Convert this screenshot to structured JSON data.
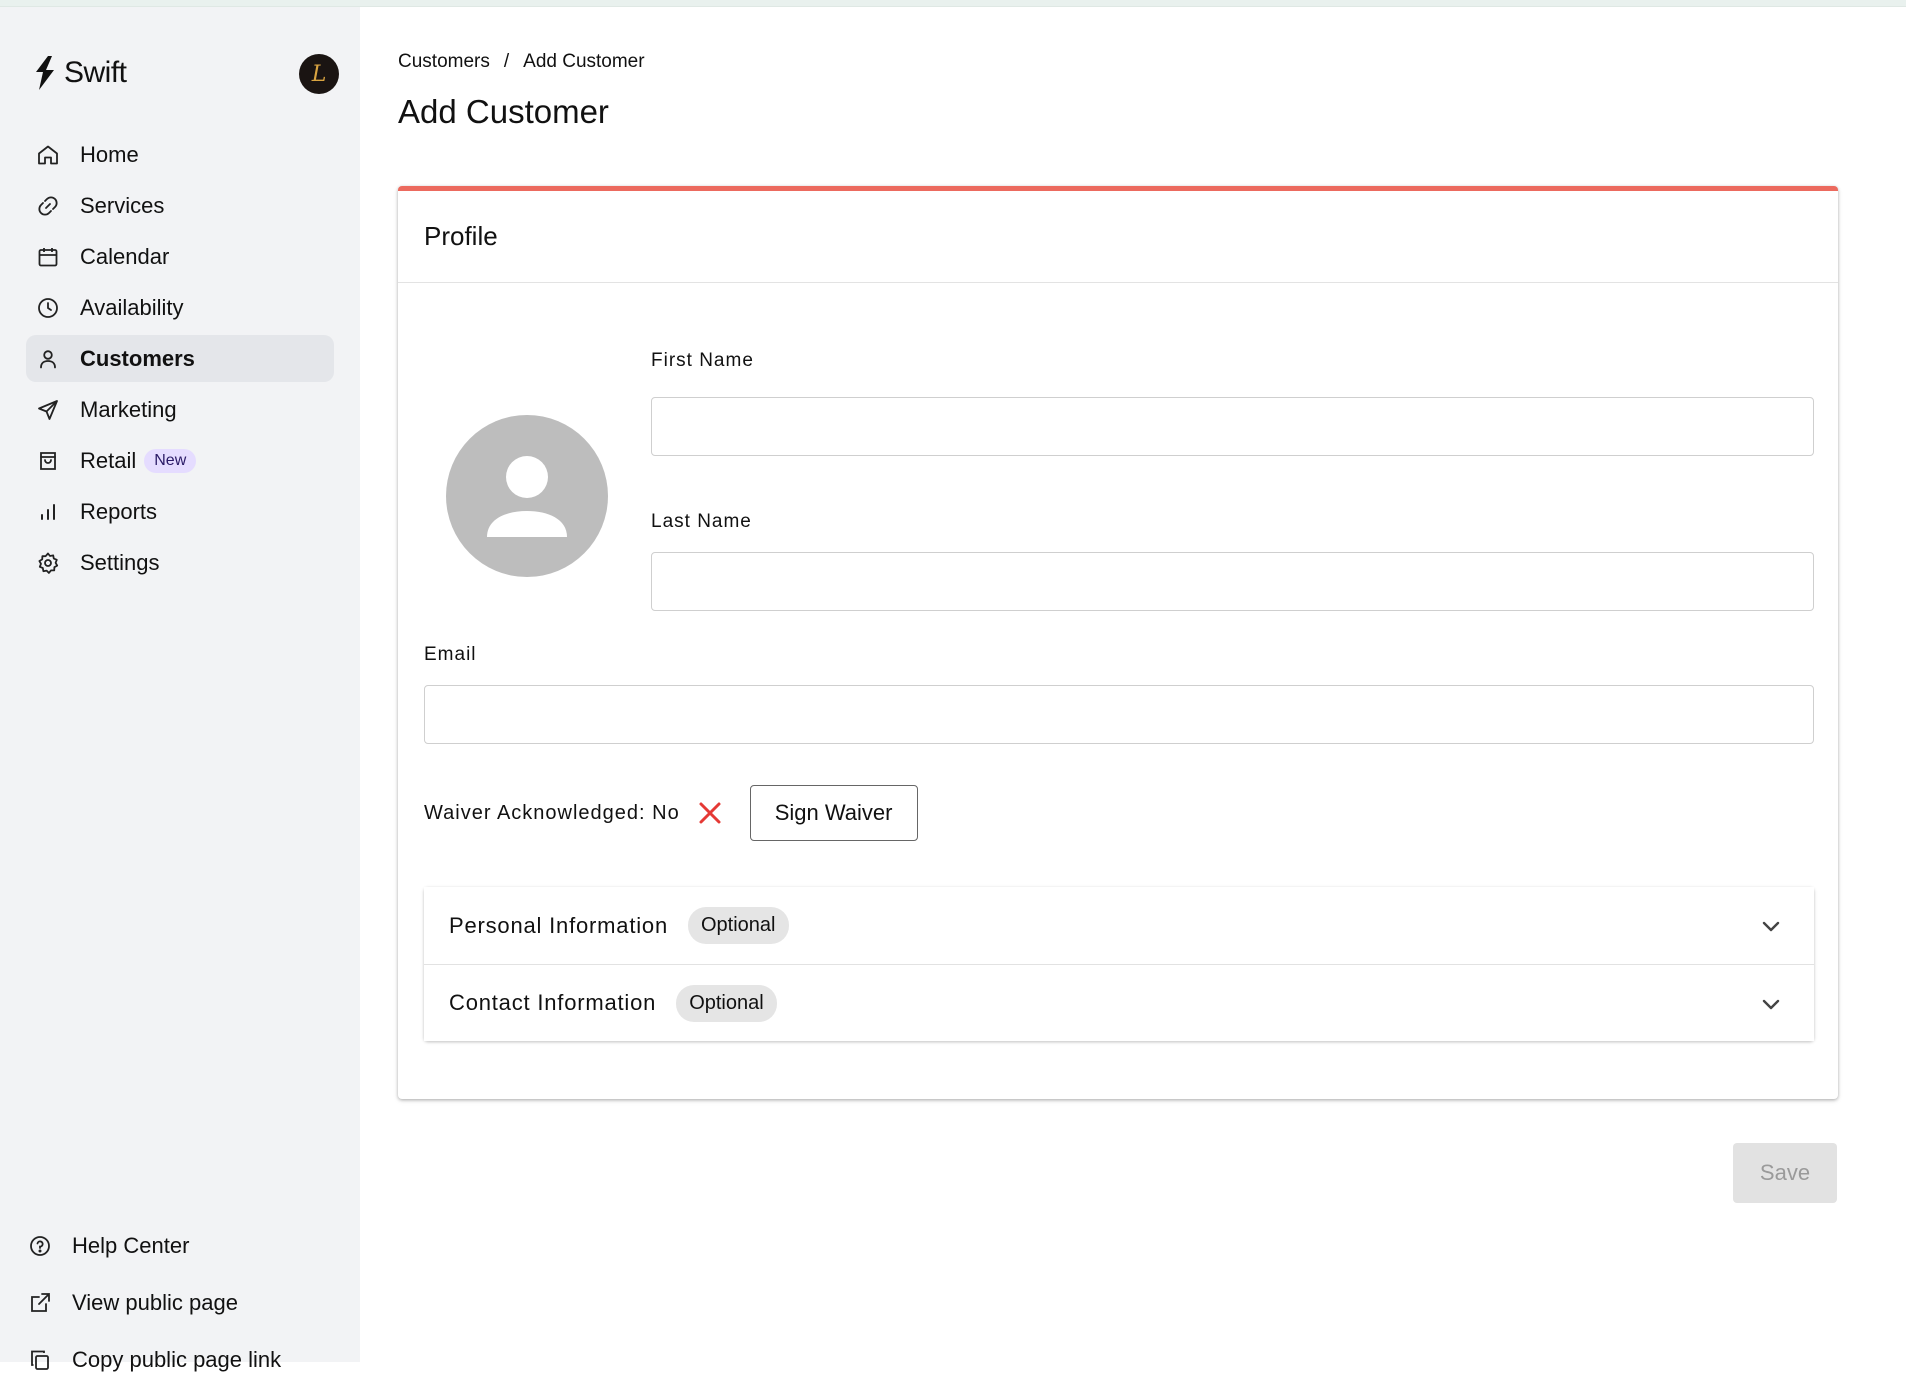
{
  "app": {
    "name": "Swift",
    "account_initial": "L"
  },
  "sidebar": {
    "items": [
      {
        "label": "Home",
        "icon": "home-icon"
      },
      {
        "label": "Services",
        "icon": "link-icon"
      },
      {
        "label": "Calendar",
        "icon": "calendar-icon"
      },
      {
        "label": "Availability",
        "icon": "clock-icon"
      },
      {
        "label": "Customers",
        "icon": "user-icon",
        "active": true
      },
      {
        "label": "Marketing",
        "icon": "send-icon"
      },
      {
        "label": "Retail",
        "icon": "bag-icon",
        "badge": "New"
      },
      {
        "label": "Reports",
        "icon": "bar-chart-icon"
      },
      {
        "label": "Settings",
        "icon": "gear-icon"
      }
    ],
    "bottom": [
      {
        "label": "Help Center",
        "icon": "help-circle-icon"
      },
      {
        "label": "View public page",
        "icon": "external-link-icon"
      },
      {
        "label": "Copy public page link",
        "icon": "copy-icon"
      }
    ]
  },
  "breadcrumb": {
    "parent": "Customers",
    "separator": "/",
    "current": "Add Customer"
  },
  "page": {
    "title": "Add Customer"
  },
  "profile_card": {
    "title": "Profile",
    "accent_color": "#ec6a5e",
    "first_name": {
      "label": "First Name",
      "value": ""
    },
    "last_name": {
      "label": "Last Name",
      "value": ""
    },
    "email": {
      "label": "Email",
      "value": ""
    },
    "waiver": {
      "text": "Waiver Acknowledged: No",
      "status_icon": "close-icon",
      "status_color": "#e53935",
      "button_label": "Sign Waiver"
    },
    "sections": [
      {
        "title": "Personal Information",
        "chip": "Optional"
      },
      {
        "title": "Contact Information",
        "chip": "Optional"
      }
    ]
  },
  "actions": {
    "save_label": "Save",
    "save_disabled": true
  }
}
